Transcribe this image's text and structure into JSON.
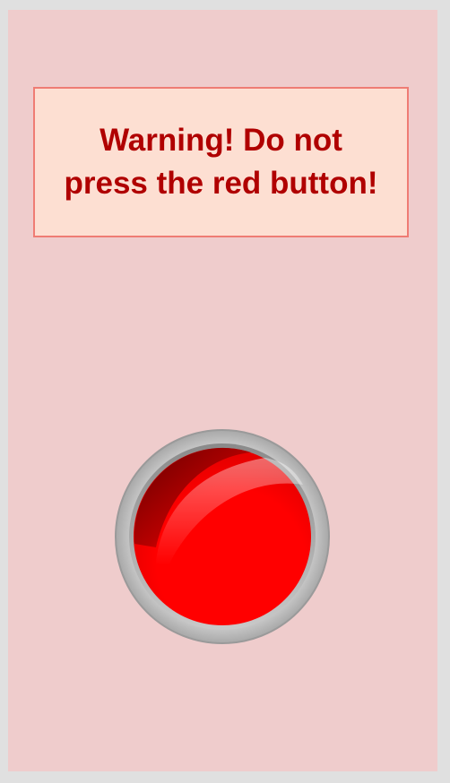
{
  "warning": {
    "line1": "Warning! Do not",
    "line2": "press the red button!"
  },
  "colors": {
    "page_background": "#e0e0e0",
    "panel_background": "#efcccc",
    "warning_background": "#fddfd2",
    "warning_border": "#ef7c74",
    "warning_text": "#b00000",
    "button_red": "#ff0000",
    "button_bezel": "#b5b5b5"
  },
  "button": {
    "icon": "big-red-button-icon"
  }
}
